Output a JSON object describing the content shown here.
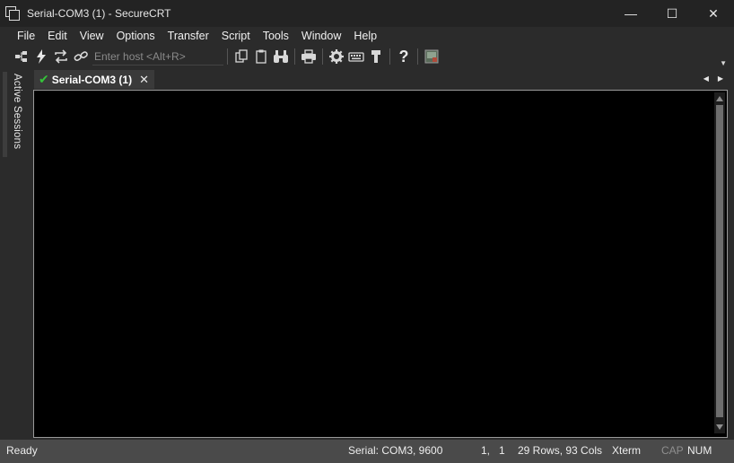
{
  "window": {
    "title": "Serial-COM3 (1) - SecureCRT",
    "minimize": "—",
    "maximize": "☐",
    "close": "✕"
  },
  "menu": [
    "File",
    "Edit",
    "View",
    "Options",
    "Transfer",
    "Script",
    "Tools",
    "Window",
    "Help"
  ],
  "toolbar": {
    "host_placeholder": "Enter host <Alt+R>",
    "icons": [
      "connect-icon",
      "quick-connect-icon",
      "reconnect-icon",
      "disconnect-icon",
      "copy-icon",
      "paste-icon",
      "find-icon",
      "print-icon",
      "session-options-icon",
      "keymap-icon",
      "sftp-icon",
      "help-icon",
      "screen-icon"
    ]
  },
  "sidebar": {
    "label": "Active Sessions"
  },
  "tabs": [
    {
      "label": "Serial-COM3 (1)",
      "status": "connected",
      "status_color": "#35c33a"
    }
  ],
  "status": {
    "ready": "Ready",
    "connection": "Serial: COM3, 9600",
    "cursor": "1,   1",
    "size": "29 Rows, 93 Cols",
    "emulation": "Xterm",
    "cap": "CAP",
    "num": "NUM"
  },
  "colors": {
    "titlebar": "#232323",
    "chrome": "#2b2b2b",
    "terminal_bg": "#000000",
    "statusbar": "#4a4a4a",
    "connected": "#35c33a"
  }
}
